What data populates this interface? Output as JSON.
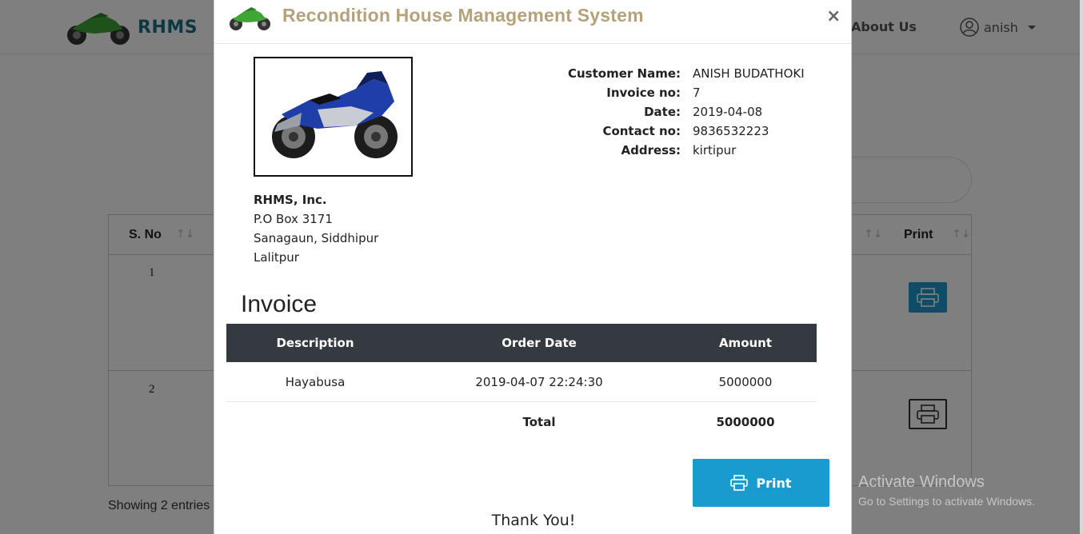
{
  "navbar": {
    "brand": "RHMS",
    "about_label": "About Us",
    "user_name": "anish"
  },
  "background_table": {
    "columns": [
      "S. No",
      "Print"
    ],
    "row_numbers": [
      "1",
      "2"
    ],
    "showing_text": "Showing 2 entries"
  },
  "modal": {
    "title": "Recondition House Management System",
    "close_label": "×",
    "company": {
      "name": "RHMS, Inc.",
      "line1": "P.O Box 3171",
      "line2": "Sanagaun, Siddhipur",
      "line3": "Lalitpur"
    },
    "customer": {
      "name_label": "Customer Name:",
      "name": "ANISH BUDATHOKI",
      "invoice_label": "Invoice no:",
      "invoice_no": "7",
      "date_label": "Date:",
      "date": "2019-04-08",
      "contact_label": "Contact no:",
      "contact": "9836532223",
      "address_label": "Address:",
      "address": "kirtipur"
    },
    "invoice_heading": "Invoice",
    "table": {
      "headers": [
        "Description",
        "Order Date",
        "Amount"
      ],
      "rows": [
        {
          "description": "Hayabusa",
          "order_date": "2019-04-07 22:24:30",
          "amount": "5000000"
        }
      ],
      "total_label": "Total",
      "total_amount": "5000000"
    },
    "print_label": "Print",
    "thanks": "Thank You!"
  },
  "watermark": {
    "line1": "Activate Windows",
    "line2": "Go to Settings to activate Windows."
  },
  "colors": {
    "brand": "#1b6f86",
    "title": "#b4a37a",
    "print_button": "#1a9bcf",
    "table_header": "#343a40"
  }
}
